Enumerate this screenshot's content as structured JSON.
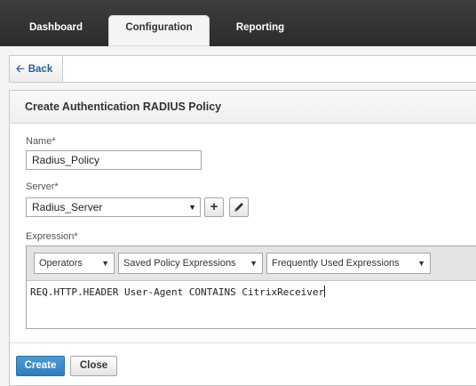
{
  "nav": {
    "tabs": [
      {
        "label": "Dashboard",
        "active": false
      },
      {
        "label": "Configuration",
        "active": true
      },
      {
        "label": "Reporting",
        "active": false
      }
    ]
  },
  "back": {
    "label": "Back",
    "icon": "arrow-left-icon"
  },
  "panel": {
    "title": "Create Authentication RADIUS Policy",
    "name": {
      "label": "Name*",
      "value": "Radius_Policy"
    },
    "server": {
      "label": "Server*",
      "value": "Radius_Server",
      "add_icon": "plus-icon",
      "edit_icon": "pencil-icon"
    },
    "expression": {
      "label": "Expression*",
      "dropdowns": [
        "Operators",
        "Saved Policy Expressions",
        "Frequently Used Expressions"
      ],
      "value": "REQ.HTTP.HEADER User-Agent CONTAINS CitrixReceiver"
    },
    "buttons": {
      "create": "Create",
      "close": "Close"
    }
  },
  "colors": {
    "primary_button": "#2f7dbd",
    "topbar": "#333333",
    "link": "#2a5f97"
  }
}
